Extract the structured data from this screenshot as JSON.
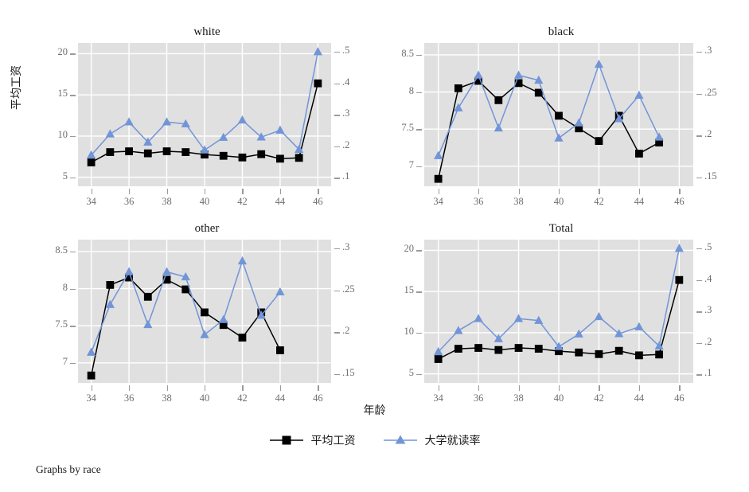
{
  "figure": {
    "ylabel": "平均工资",
    "xlabel": "年龄",
    "note": "Graphs by race",
    "series_colors": {
      "wage": "#000000",
      "college": "#7295d8"
    },
    "panel_bg": "#e0e0e0",
    "grid_color": "#ffffff",
    "tick_color": "#6e6e6e"
  },
  "legend": {
    "items": [
      {
        "label": "平均工资",
        "marker": "square",
        "color": "#000000"
      },
      {
        "label": "大学就读率",
        "marker": "triangle",
        "color": "#7295d8"
      }
    ]
  },
  "chart_data": {
    "type": "line",
    "title": "",
    "xlabel": "年龄",
    "ylabel": "平均工资",
    "note": "Graphs by race",
    "grid": true,
    "legend_position": "bottom",
    "panels": [
      {
        "name": "white",
        "title": "white",
        "xlim": [
          33.3,
          46.7
        ],
        "xticks": [
          34,
          36,
          38,
          40,
          42,
          44,
          46
        ],
        "xticklabels": [
          "34",
          "36",
          "38",
          "40",
          "42",
          "44",
          "46"
        ],
        "left_axis": {
          "label": "平均工资",
          "ylim": [
            3.9,
            21.3
          ],
          "yticks": [
            5,
            10,
            15,
            20
          ],
          "yticklabels": [
            "5",
            "10",
            "15",
            "20"
          ]
        },
        "right_axis": {
          "label": "大学就读率",
          "ylim": [
            0.073,
            0.528
          ],
          "yticks": [
            0.1,
            0.2,
            0.3,
            0.4,
            0.5
          ],
          "yticklabels": [
            ".1",
            ".2",
            ".3",
            ".4",
            ".5"
          ]
        },
        "x": [
          34,
          35,
          36,
          37,
          38,
          39,
          40,
          41,
          42,
          43,
          44,
          45,
          46
        ],
        "series": [
          {
            "name": "平均工资",
            "axis": "left",
            "marker": "square",
            "color": "#000000",
            "values": [
              6.8,
              8.05,
              8.15,
              7.9,
              8.15,
              8.05,
              7.75,
              7.6,
              7.4,
              7.8,
              7.25,
              7.35,
              16.4
            ]
          },
          {
            "name": "大学就读率",
            "axis": "right",
            "marker": "triangle",
            "color": "#7295d8",
            "values": [
              0.172,
              0.239,
              0.277,
              0.213,
              0.277,
              0.271,
              0.188,
              0.228,
              0.283,
              0.229,
              0.251,
              0.19,
              0.5
            ]
          }
        ]
      },
      {
        "name": "black",
        "title": "black",
        "xlim": [
          33.3,
          46.7
        ],
        "xticks": [
          34,
          36,
          38,
          40,
          42,
          44,
          46
        ],
        "xticklabels": [
          "34",
          "36",
          "38",
          "40",
          "42",
          "44",
          "46"
        ],
        "left_axis": {
          "label": "平均工资",
          "ylim": [
            6.73,
            8.66
          ],
          "yticks": [
            7,
            7.5,
            8,
            8.5
          ],
          "yticklabels": [
            "7",
            "7.5",
            "8",
            "8.5"
          ]
        },
        "right_axis": {
          "label": "大学就读率",
          "ylim": [
            0.1395,
            0.3105
          ],
          "yticks": [
            0.15,
            0.2,
            0.25,
            0.3
          ],
          "yticklabels": [
            ".15",
            ".2",
            ".25",
            ".3"
          ]
        },
        "x": [
          34,
          35,
          36,
          37,
          38,
          39,
          40,
          41,
          42,
          43,
          44,
          45
        ],
        "series": [
          {
            "name": "平均工资",
            "axis": "left",
            "marker": "square",
            "color": "#000000",
            "values": [
              6.83,
              8.05,
              8.15,
              7.89,
              8.12,
              7.99,
              7.68,
              7.51,
              7.34,
              7.68,
              7.17,
              7.32
            ]
          },
          {
            "name": "大学就读率",
            "axis": "right",
            "marker": "triangle",
            "color": "#7295d8",
            "values": [
              0.176,
              0.233,
              0.272,
              0.209,
              0.272,
              0.266,
              0.197,
              0.215,
              0.285,
              0.22,
              0.248,
              0.198
            ]
          }
        ]
      },
      {
        "name": "other",
        "title": "other",
        "xlim": [
          33.3,
          46.7
        ],
        "xticks": [
          34,
          36,
          38,
          40,
          42,
          44,
          46
        ],
        "xticklabels": [
          "34",
          "36",
          "38",
          "40",
          "42",
          "44",
          "46"
        ],
        "left_axis": {
          "label": "平均工资",
          "ylim": [
            6.73,
            8.66
          ],
          "yticks": [
            7,
            7.5,
            8,
            8.5
          ],
          "yticklabels": [
            "7",
            "7.5",
            "8",
            "8.5"
          ]
        },
        "right_axis": {
          "label": "大学就读率",
          "ylim": [
            0.1395,
            0.3105
          ],
          "yticks": [
            0.15,
            0.2,
            0.25,
            0.3
          ],
          "yticklabels": [
            ".15",
            ".2",
            ".25",
            ".3"
          ]
        },
        "x": [
          34,
          35,
          36,
          37,
          38,
          39,
          40,
          41,
          42,
          43,
          44
        ],
        "series": [
          {
            "name": "平均工资",
            "axis": "left",
            "marker": "square",
            "color": "#000000",
            "values": [
              6.83,
              8.05,
              8.15,
              7.89,
              8.12,
              7.99,
              7.68,
              7.51,
              7.34,
              7.68,
              7.17
            ]
          },
          {
            "name": "大学就读率",
            "axis": "right",
            "marker": "triangle",
            "color": "#7295d8",
            "values": [
              0.176,
              0.233,
              0.272,
              0.209,
              0.272,
              0.266,
              0.197,
              0.215,
              0.285,
              0.22,
              0.248
            ]
          }
        ]
      },
      {
        "name": "Total",
        "title": "Total",
        "xlim": [
          33.3,
          46.7
        ],
        "xticks": [
          34,
          36,
          38,
          40,
          42,
          44,
          46
        ],
        "xticklabels": [
          "34",
          "36",
          "38",
          "40",
          "42",
          "44",
          "46"
        ],
        "left_axis": {
          "label": "平均工资",
          "ylim": [
            3.9,
            21.3
          ],
          "yticks": [
            5,
            10,
            15,
            20
          ],
          "yticklabels": [
            "5",
            "10",
            "15",
            "20"
          ]
        },
        "right_axis": {
          "label": "大学就读率",
          "ylim": [
            0.073,
            0.528
          ],
          "yticks": [
            0.1,
            0.2,
            0.3,
            0.4,
            0.5
          ],
          "yticklabels": [
            ".1",
            ".2",
            ".3",
            ".4",
            ".5"
          ]
        },
        "x": [
          34,
          35,
          36,
          37,
          38,
          39,
          40,
          41,
          42,
          43,
          44,
          45,
          46
        ],
        "series": [
          {
            "name": "平均工资",
            "axis": "left",
            "marker": "square",
            "color": "#000000",
            "values": [
              6.8,
              8.05,
              8.15,
              7.9,
              8.15,
              8.05,
              7.75,
              7.6,
              7.4,
              7.8,
              7.25,
              7.35,
              16.4
            ]
          },
          {
            "name": "大学就读率",
            "axis": "right",
            "marker": "triangle",
            "color": "#7295d8",
            "values": [
              0.172,
              0.239,
              0.277,
              0.213,
              0.277,
              0.271,
              0.188,
              0.228,
              0.283,
              0.229,
              0.251,
              0.19,
              0.5
            ]
          }
        ]
      }
    ]
  }
}
